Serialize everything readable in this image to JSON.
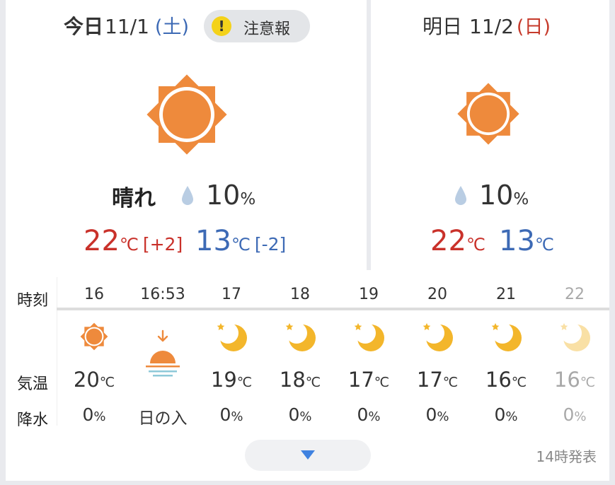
{
  "today": {
    "label": "今日",
    "date": "11/1",
    "dow": "(土)",
    "alert": "注意報",
    "alert_icon": "!",
    "weather": "晴れ",
    "precip": "10",
    "precip_unit": "%",
    "high": "22",
    "high_diff": "[+2]",
    "low": "13",
    "low_diff": "[-2]",
    "temp_unit": "℃"
  },
  "tomorrow": {
    "label": "明日",
    "date": "11/2",
    "dow": "(日)",
    "precip": "10",
    "precip_unit": "%",
    "high": "22",
    "low": "13",
    "temp_unit": "℃"
  },
  "hourly": {
    "labels": {
      "time": "時刻",
      "temp": "気温",
      "rain": "降水"
    },
    "temp_unit": "℃",
    "rain_unit": "%",
    "sunset_label": "日の入",
    "columns": [
      {
        "time": "16",
        "icon": "sun-icon",
        "temp": "20",
        "rain": "0"
      },
      {
        "time": "16:53",
        "icon": "sunset-icon",
        "temp": "",
        "rain": ""
      },
      {
        "time": "17",
        "icon": "moon-icon",
        "temp": "19",
        "rain": "0"
      },
      {
        "time": "18",
        "icon": "moon-icon",
        "temp": "18",
        "rain": "0"
      },
      {
        "time": "19",
        "icon": "moon-icon",
        "temp": "17",
        "rain": "0"
      },
      {
        "time": "20",
        "icon": "moon-icon",
        "temp": "17",
        "rain": "0"
      },
      {
        "time": "21",
        "icon": "moon-icon",
        "temp": "16",
        "rain": "0"
      },
      {
        "time": "22",
        "icon": "moon-icon",
        "temp": "16",
        "rain": "0"
      }
    ],
    "issued": "14時発表"
  },
  "colors": {
    "sun_orange": "#ee8a3c",
    "moon_yellow": "#f3b62b",
    "high_red": "#c9312a",
    "low_blue": "#3d6ab5",
    "drop_blue": "#b9cde3",
    "alert_yellow": "#f4d21a",
    "expand_arrow": "#3f82e0"
  }
}
